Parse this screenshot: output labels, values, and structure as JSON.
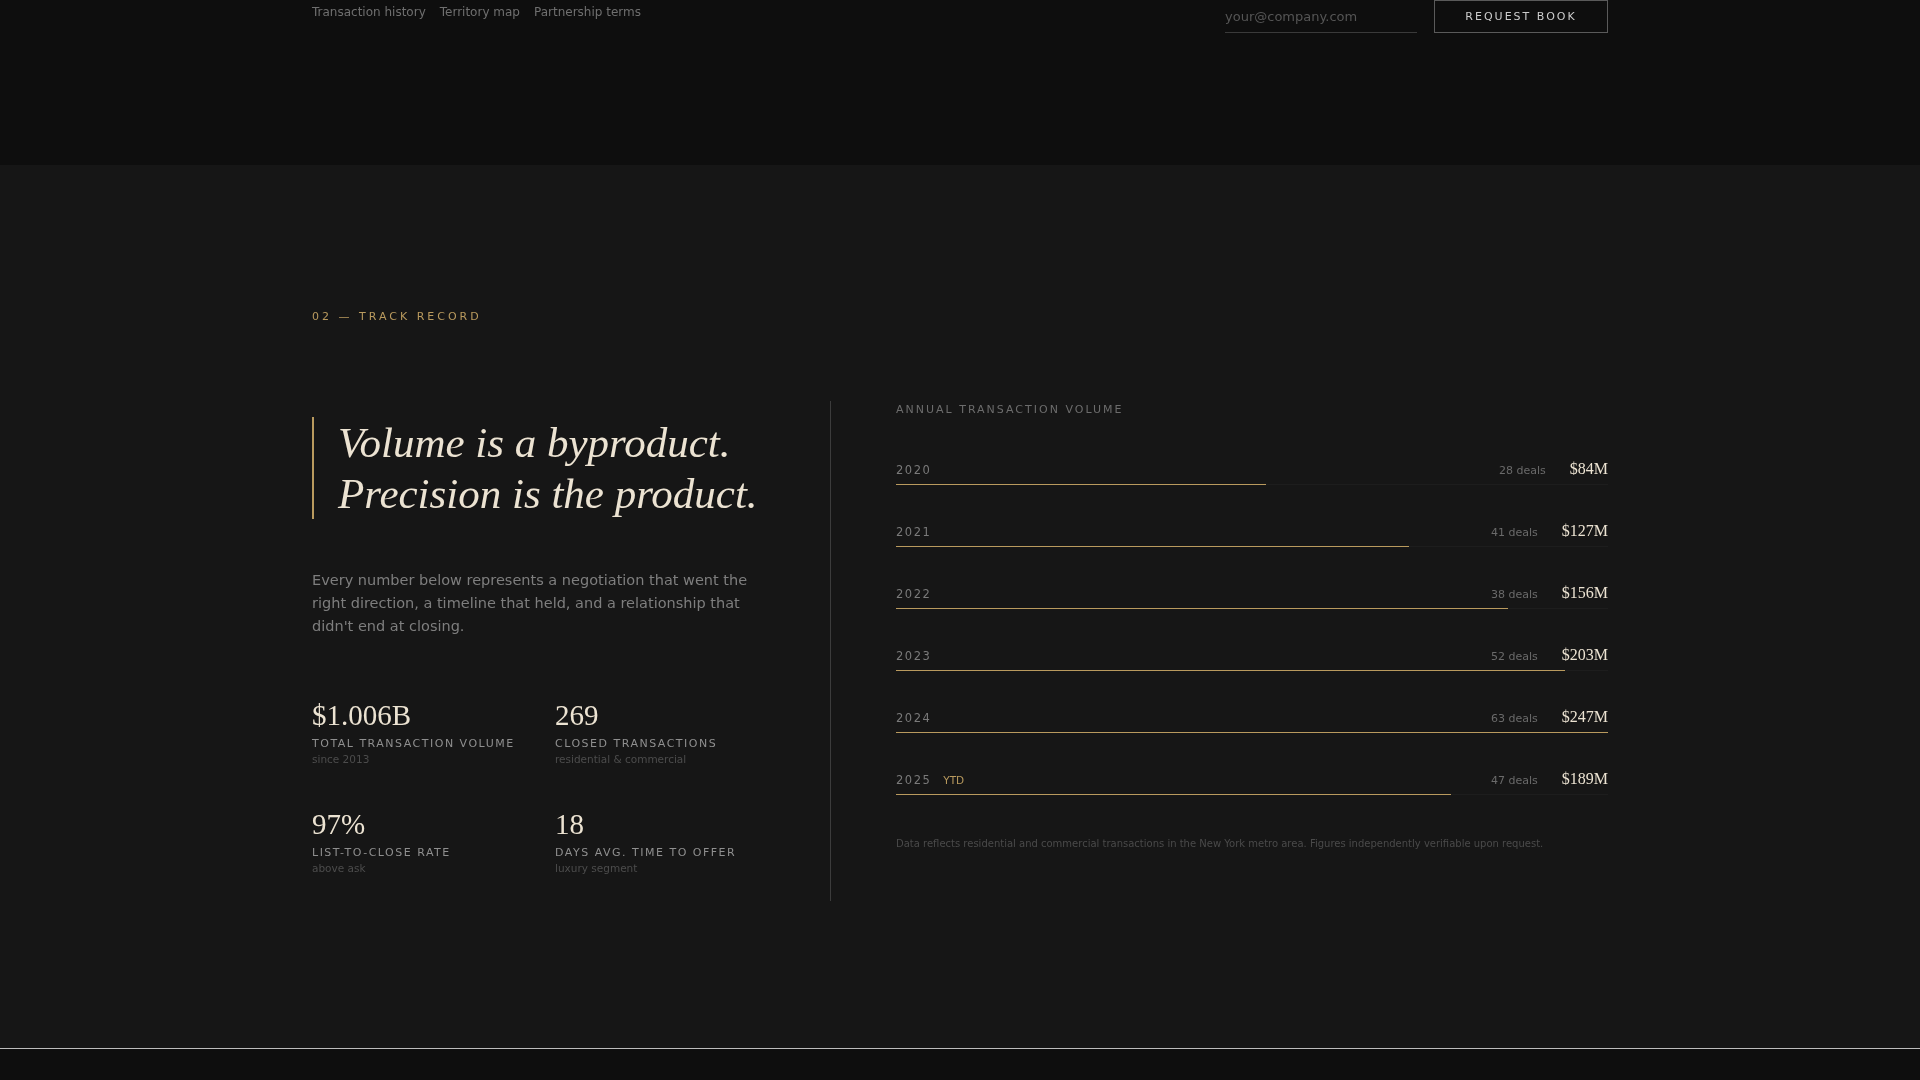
{
  "header": {
    "links": [
      "Transaction history",
      "Territory map",
      "Partnership terms"
    ],
    "email_field": {
      "placeholder": "your@company.com"
    },
    "button": "REQUEST BOOK"
  },
  "section": {
    "eyebrow": "02 — TRACK RECORD",
    "headline": [
      "Volume is a byproduct.",
      "Precision is the product."
    ],
    "intro": "Every number below represents a negotiation that went the right direction, a timeline that held, and a relationship that didn't end at closing.",
    "stats": [
      {
        "value": "$1.006B",
        "label": "TOTAL TRANSACTION VOLUME",
        "note": "since 2013"
      },
      {
        "value": "269",
        "label": "CLOSED TRANSACTIONS",
        "note": "residential & commercial"
      },
      {
        "value": "97%",
        "label": "LIST-TO-CLOSE RATE",
        "note": "above ask"
      },
      {
        "value": "18",
        "label": "DAYS AVG. TIME TO OFFER",
        "note": "luxury segment"
      }
    ],
    "volume": {
      "title": "ANNUAL TRANSACTION VOLUME",
      "rows": [
        {
          "year": "2020",
          "deals": "28 deals",
          "amount": "$84M",
          "level": 0.52
        },
        {
          "year": "2021",
          "deals": "41 deals",
          "amount": "$127M",
          "level": 0.72
        },
        {
          "year": "2022",
          "deals": "38 deals",
          "amount": "$156M",
          "level": 0.86
        },
        {
          "year": "2023",
          "deals": "52 deals",
          "amount": "$203M",
          "level": 0.94
        },
        {
          "year": "2024",
          "deals": "63 deals",
          "amount": "$247M",
          "level": 1.0
        },
        {
          "year": "2025",
          "tag": "YTD",
          "deals": "47 deals",
          "amount": "$189M",
          "level": 0.78
        }
      ],
      "footnote": "Data reflects residential and commercial transactions in the New York metro area. Figures independently verifiable upon request."
    }
  }
}
